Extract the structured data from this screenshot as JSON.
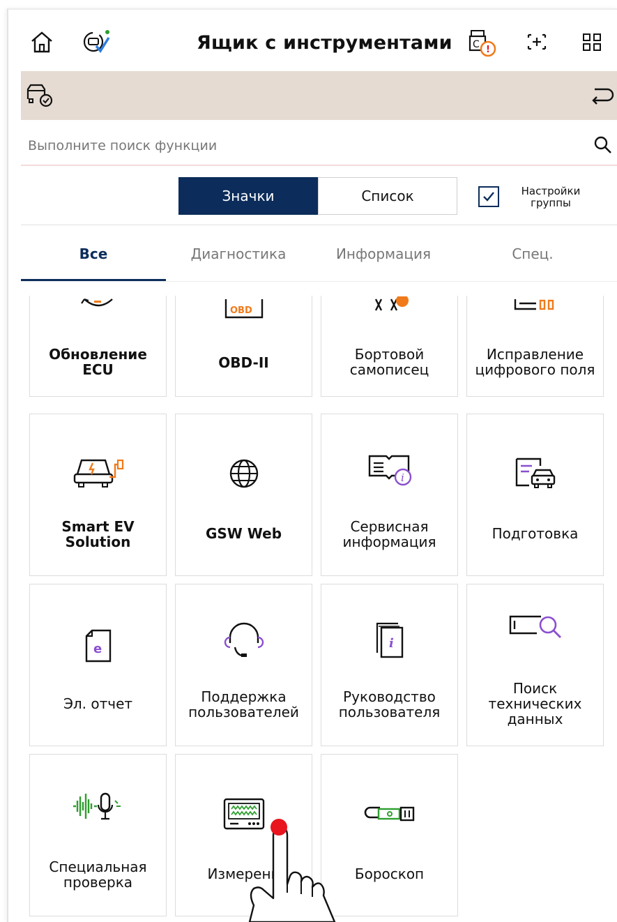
{
  "header": {
    "title": "Ящик с инструментами",
    "icons": [
      "home-icon",
      "sync-check-icon",
      "vci-alert-icon",
      "capture-icon",
      "grid-menu-icon"
    ]
  },
  "vehicle_bar": {
    "icons": [
      "vehicle-check-icon",
      "return-icon"
    ]
  },
  "search": {
    "placeholder": "Выполните поиск функции"
  },
  "view_toggle": {
    "icons_label": "Значки",
    "list_label": "Список",
    "selected": "Значки"
  },
  "group_settings": {
    "label": "Настройки группы",
    "checked": true
  },
  "tabs": [
    {
      "label": "Все",
      "active": true
    },
    {
      "label": "Диагностика",
      "active": false
    },
    {
      "label": "Информация",
      "active": false
    },
    {
      "label": "Спец.",
      "active": false
    }
  ],
  "tools": [
    {
      "label": "Обновление ECU",
      "icon": "ecu-update-icon"
    },
    {
      "label": "OBD-II",
      "icon": "obd-icon",
      "icon_text": "OBD"
    },
    {
      "label": "Бортовой самописец",
      "icon": "recorder-icon"
    },
    {
      "label": "Исправление цифрового поля",
      "icon": "digital-field-icon"
    },
    {
      "label": "Smart EV Solution",
      "icon": "ev-car-icon"
    },
    {
      "label": "GSW Web",
      "icon": "globe-icon"
    },
    {
      "label": "Сервисная информация",
      "icon": "service-book-icon"
    },
    {
      "label": "Подготовка",
      "icon": "preparation-icon"
    },
    {
      "label": "Эл. отчет",
      "icon": "e-report-icon",
      "icon_text": "e"
    },
    {
      "label": "Поддержка пользователей",
      "icon": "headset-icon"
    },
    {
      "label": "Руководство пользователя",
      "icon": "manual-icon",
      "icon_text": "i"
    },
    {
      "label": "Поиск технических данных",
      "icon": "tech-search-icon"
    },
    {
      "label": "Специальная проверка",
      "icon": "voice-test-icon"
    },
    {
      "label": "Измерени",
      "icon": "oscilloscope-icon"
    },
    {
      "label": "Бороскоп",
      "icon": "borescope-icon"
    }
  ],
  "colors": {
    "navy": "#0c2d5b",
    "strip": "#e5dbd2",
    "accent_orange": "#f07a1a",
    "accent_purple": "#8a4fd0",
    "accent_green": "#2e9e2e",
    "touch_red": "#e8141e"
  }
}
